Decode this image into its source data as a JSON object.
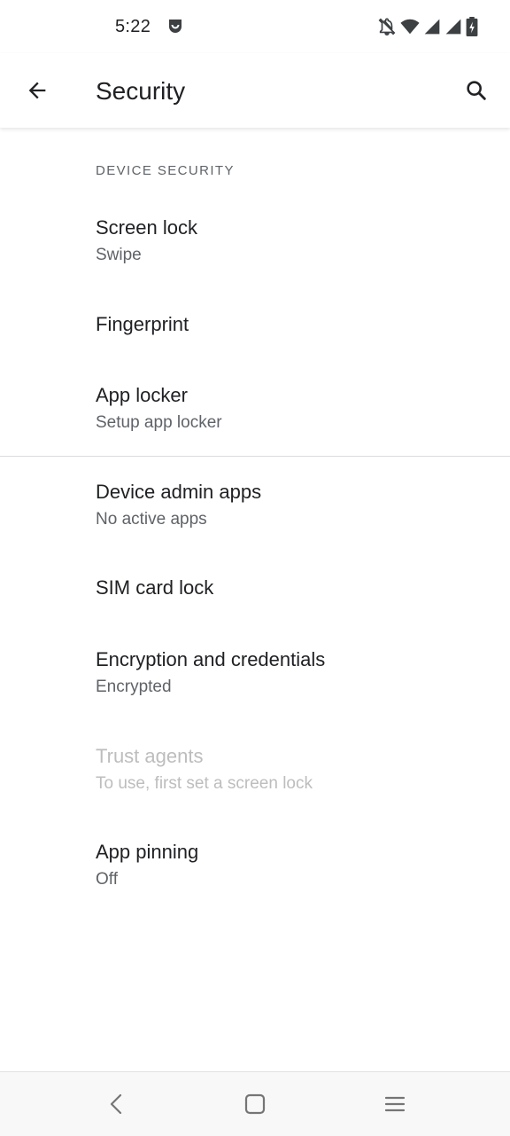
{
  "status_bar": {
    "time": "5:22",
    "app_icon": "notification-app-icon",
    "icons": [
      "bell-off-icon",
      "wifi-icon",
      "signal-icon",
      "signal-icon",
      "battery-charging-icon"
    ]
  },
  "app_bar": {
    "title": "Security",
    "back_icon": "arrow-back-icon",
    "search_icon": "search-icon"
  },
  "section": {
    "header": "DEVICE SECURITY"
  },
  "items": [
    {
      "title": "Screen lock",
      "summary": "Swipe",
      "enabled": true
    },
    {
      "title": "Fingerprint",
      "summary": "",
      "enabled": true
    },
    {
      "title": "App locker",
      "summary": "Setup app locker",
      "enabled": true
    },
    {
      "title": "Device admin apps",
      "summary": "No active apps",
      "enabled": true
    },
    {
      "title": "SIM card lock",
      "summary": "",
      "enabled": true
    },
    {
      "title": "Encryption and credentials",
      "summary": "Encrypted",
      "enabled": true
    },
    {
      "title": "Trust agents",
      "summary": "To use, first set a screen lock",
      "enabled": false
    },
    {
      "title": "App pinning",
      "summary": "Off",
      "enabled": true
    }
  ],
  "nav_bar": {
    "icons": [
      "nav-back-icon",
      "nav-home-icon",
      "nav-recents-icon"
    ]
  },
  "colors": {
    "text_primary": "#202124",
    "text_secondary": "#5f6368",
    "text_disabled": "#bdbdbd",
    "divider": "#dadce0"
  }
}
